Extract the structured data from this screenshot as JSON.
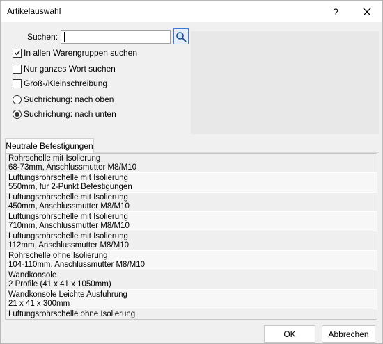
{
  "window": {
    "title": "Artikelauswahl",
    "help_glyph": "?"
  },
  "search": {
    "label": "Suchen:",
    "value": "",
    "placeholder": ""
  },
  "options": {
    "all_groups": {
      "label": "In allen Warengruppen suchen",
      "checked": true
    },
    "whole_word": {
      "label": "Nur ganzes Wort suchen",
      "checked": false
    },
    "case_sensitive": {
      "label": "Groß-/Kleinschreibung",
      "checked": false
    },
    "direction_up": {
      "label": "Suchrichung: nach oben",
      "selected": false
    },
    "direction_down": {
      "label": "Suchrichung: nach unten",
      "selected": true
    }
  },
  "tab": {
    "label": "Neutrale Befestigungen"
  },
  "items": [
    {
      "line1": "Rohrschelle mit Isolierung",
      "line2": "68-73mm, Anschlussmutter M8/M10"
    },
    {
      "line1": "Luftungsrohrschelle mit Isolierung",
      "line2": "550mm, fur 2-Punkt Befestigungen"
    },
    {
      "line1": "Luftungsrohrschelle mit Isolierung",
      "line2": "450mm, Anschlussmutter M8/M10"
    },
    {
      "line1": "Luftungsrohrschelle mit Isolierung",
      "line2": "710mm, Anschlussmutter M8/M10"
    },
    {
      "line1": "Luftungsrohrschelle mit Isolierung",
      "line2": "112mm, Anschlussmutter M8/M10"
    },
    {
      "line1": "Rohrschelle ohne Isolierung",
      "line2": "104-110mm, Anschlussmutter M8/M10"
    },
    {
      "line1": "Wandkonsole",
      "line2": "2 Profile (41 x 41 x 1050mm)"
    },
    {
      "line1": "Wandkonsole Leichte Ausfuhrung",
      "line2": "21 x 41 x 300mm"
    },
    {
      "line1": "Luftungsrohrschelle ohne Isolierung",
      "line2": ""
    }
  ],
  "buttons": {
    "ok": "OK",
    "cancel": "Abbrechen"
  },
  "icons": {
    "search": "search-icon",
    "close": "close-icon",
    "check": "check-icon"
  }
}
